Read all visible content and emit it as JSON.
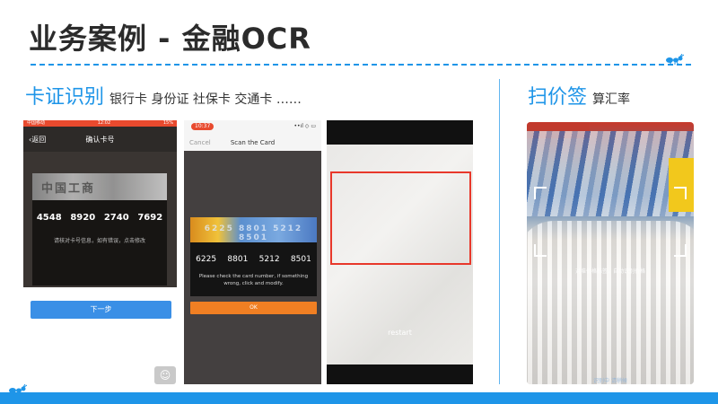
{
  "title": "业务案例 - 金融OCR",
  "section_left": {
    "heading": "卡证识别",
    "subtitle": "银行卡 身份证 社保卡 交通卡 ……"
  },
  "section_right": {
    "heading": "扫价签",
    "subtitle": "算汇率"
  },
  "phone1": {
    "status_carrier": "中国移动",
    "status_time": "12:02",
    "status_battery": "15%",
    "back_label": "返回",
    "nav_title": "确认卡号",
    "ghost_text": "中国工商",
    "card_groups": [
      "4548",
      "8920",
      "2740",
      "7692"
    ],
    "hint": "请核对卡号信息，如有错误，点击修改",
    "next_button": "下一步",
    "corner_icon": "☺"
  },
  "phone2": {
    "time": "10:37",
    "signal": "••ıl ◇ ▭",
    "cancel": "Cancel",
    "nav_title": "Scan the Card",
    "ghost_number": "6225  8801  5212  8501",
    "card_groups": [
      "6225",
      "8801",
      "5212",
      "8501"
    ],
    "hint": "Please check the card number, if something wrong, click and modify.",
    "ok_button": "OK"
  },
  "phone3": {
    "restart": "restart"
  },
  "phone4": {
    "hint": "对准价格标签，自动识别价格",
    "footer": "识别中 请稍候"
  },
  "colors": {
    "accent": "#1e95e8",
    "title": "#2b2b2b",
    "scan_frame": "#e8382b",
    "ok_button": "#f07f23",
    "next_button": "#3a8fe6"
  }
}
